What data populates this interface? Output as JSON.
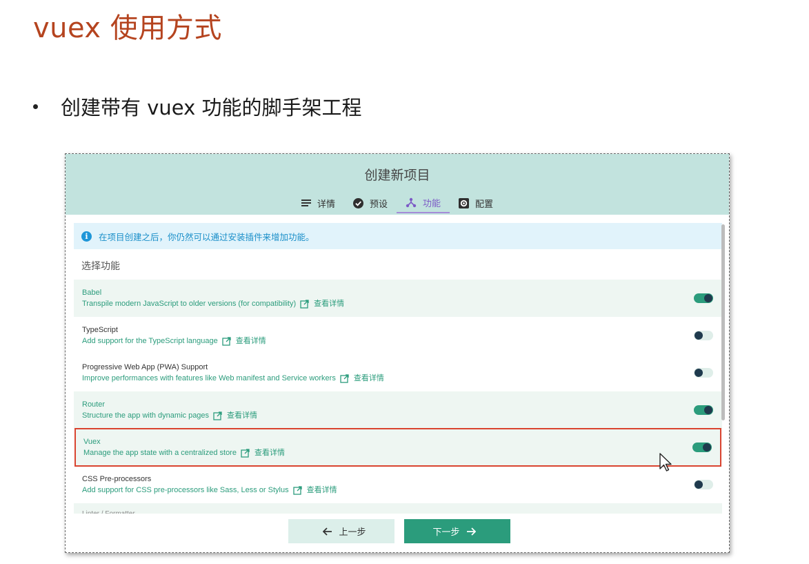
{
  "slide": {
    "title": "vuex 使用方式",
    "bullet": "创建带有 vuex 功能的脚手架工程"
  },
  "window": {
    "title": "创建新项目",
    "tabs": [
      {
        "label": "详情",
        "icon": "list-icon"
      },
      {
        "label": "预设",
        "icon": "check-circle-icon"
      },
      {
        "label": "功能",
        "icon": "fork-icon",
        "active": true
      },
      {
        "label": "配置",
        "icon": "gear-icon"
      }
    ],
    "info_text": "在项目创建之后，你仍然可以通过安装插件来增加功能。",
    "section_label": "选择功能",
    "more_label": "查看详情",
    "features": [
      {
        "name": "Babel",
        "desc": "Transpile modern JavaScript to older versions (for compatibility)",
        "enabled": true
      },
      {
        "name": "TypeScript",
        "desc": "Add support for the TypeScript language",
        "enabled": false
      },
      {
        "name": "Progressive Web App (PWA) Support",
        "desc": "Improve performances with features like Web manifest and Service workers",
        "enabled": false
      },
      {
        "name": "Router",
        "desc": "Structure the app with dynamic pages",
        "enabled": true
      },
      {
        "name": "Vuex",
        "desc": "Manage the app state with a centralized store",
        "enabled": true,
        "highlighted": true
      },
      {
        "name": "CSS Pre-processors",
        "desc": "Add support for CSS pre-processors like Sass, Less or Stylus",
        "enabled": false
      }
    ],
    "partial_row": "Linter / Formatter",
    "prev_label": "上一步",
    "next_label": "下一步"
  },
  "colors": {
    "title": "#b5441f",
    "accent": "#2b9c7c",
    "header_bg": "#c2e3de",
    "active_tab": "#7c5ac6",
    "highlight": "#d9432f"
  }
}
